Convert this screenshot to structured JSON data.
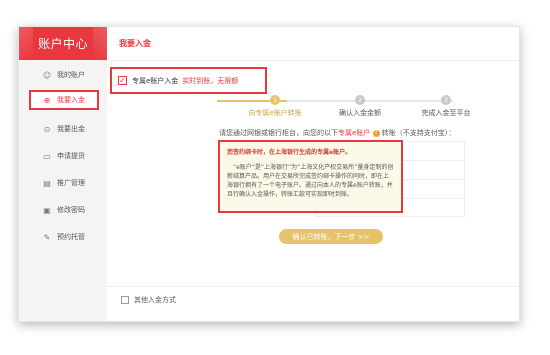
{
  "sidebar": {
    "title": "账户中心",
    "items": [
      {
        "label": "我的账户",
        "icon": "user-icon"
      },
      {
        "label": "我要入金",
        "icon": "deposit-icon"
      },
      {
        "label": "我要出金",
        "icon": "withdraw-icon"
      },
      {
        "label": "申请提货",
        "icon": "briefcase-icon"
      },
      {
        "label": "推广管理",
        "icon": "clipboard-icon"
      },
      {
        "label": "修改密码",
        "icon": "lock-icon"
      },
      {
        "label": "预约托管",
        "icon": "edit-icon"
      }
    ]
  },
  "main": {
    "title": "我要入金",
    "option": {
      "label": "专属e账户入金",
      "tip": "实时到账，无限额",
      "checked": true
    },
    "steps": [
      {
        "num": "1",
        "label": "向专属e账户转账",
        "active": true
      },
      {
        "num": "2",
        "label": "确认入金金额",
        "active": false
      },
      {
        "num": "3",
        "label": "完成入金至平台",
        "active": false
      }
    ],
    "instruction": {
      "prefix": "请您通过网银或银行柜台，向您的以下",
      "highlight": "专属e账户",
      "q": "?",
      "suffix": " 转账（不支持支付宝）："
    },
    "info": {
      "title": "您签约绑卡时，在上海银行生成的专属e账户。",
      "body": "“e账户”是“上海银行”为“上海文化产权交易所”量身定制的创新结算产品。用户在交易所完成签约绑卡操作的同时，即在上海银行拥有了一个电子账户。通过向本人的专属e账户转账，并且行确认入金操作，转账汇款可实现即时到账。"
    },
    "next_button": "确认已转账，下一步 >>",
    "other_method": "其他入金方式"
  },
  "colors": {
    "accent": "#e8373d",
    "gold": "#e5c36a",
    "sidebar_bg": "#f4f4f4"
  }
}
